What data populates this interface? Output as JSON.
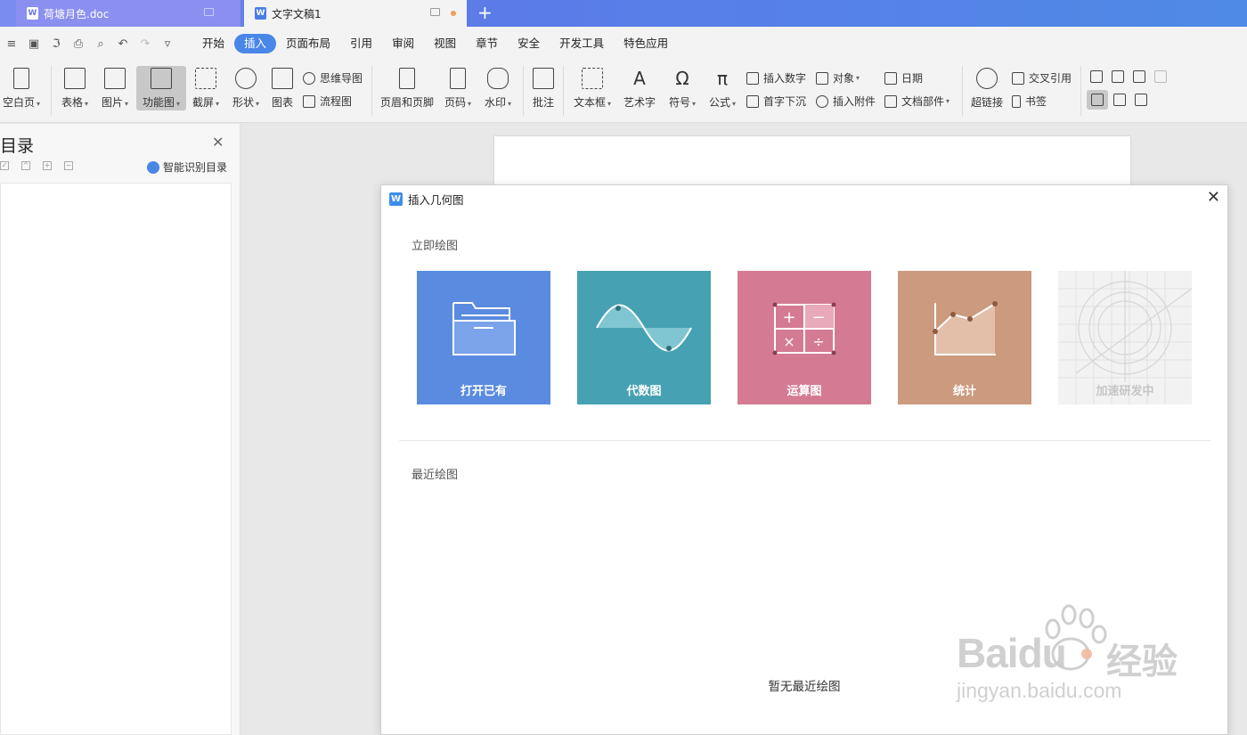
{
  "tabs": [
    {
      "label": "荷塘月色.doc",
      "icon": "doc-icon",
      "active": false
    },
    {
      "label": "文字文稿1",
      "icon": "doc-icon",
      "active": true
    }
  ],
  "new_tab_symbol": "+",
  "quick_access": [
    "save-icon",
    "format-painter-icon",
    "print-icon",
    "print-preview-icon",
    "undo-icon",
    "redo-icon",
    "more-icon"
  ],
  "menu": [
    "开始",
    "插入",
    "页面布局",
    "引用",
    "审阅",
    "视图",
    "章节",
    "安全",
    "开发工具",
    "特色应用"
  ],
  "menu_active": "插入",
  "ribbon": {
    "blank_page": "空白页",
    "table": "表格",
    "picture": "图片",
    "function_chart": "功能图",
    "screenshot": "截屏",
    "shapes": "形状",
    "chart": "图表",
    "mind_map": "思维导图",
    "flowchart": "流程图",
    "header_footer": "页眉和页脚",
    "page_number": "页码",
    "watermark": "水印",
    "comment": "批注",
    "textbox": "文本框",
    "wordart": "艺术字",
    "symbol": "符号",
    "formula": "公式",
    "insert_number": "插入数字",
    "dropcap": "首字下沉",
    "object": "对象",
    "attachment": "插入附件",
    "date": "日期",
    "doc_parts": "文档部件",
    "hyperlink": "超链接",
    "cross_ref": "交叉引用",
    "bookmark": "书签"
  },
  "nav": {
    "title": "目录",
    "smart_label": "智能识别目录"
  },
  "dialog": {
    "title": "插入几何图",
    "section_draw": "立即绘图",
    "section_recent": "最近绘图",
    "tiles": [
      {
        "label": "打开已有",
        "color": "#5a8be0",
        "icon": "folder-icon"
      },
      {
        "label": "代数图",
        "color": "#46a2b2",
        "icon": "sine-wave-icon"
      },
      {
        "label": "运算图",
        "color": "#d47b93",
        "icon": "calculator-icon"
      },
      {
        "label": "统计",
        "color": "#cc9a7e",
        "icon": "line-chart-icon"
      },
      {
        "label": "加速研发中",
        "color": "#f2f2f2",
        "icon": "geometry-sketch-icon"
      }
    ],
    "empty_recent": "暂无最近绘图"
  },
  "watermark": {
    "brand": "Baidu",
    "cn": "经验",
    "url": "jingyan.baidu.com"
  }
}
